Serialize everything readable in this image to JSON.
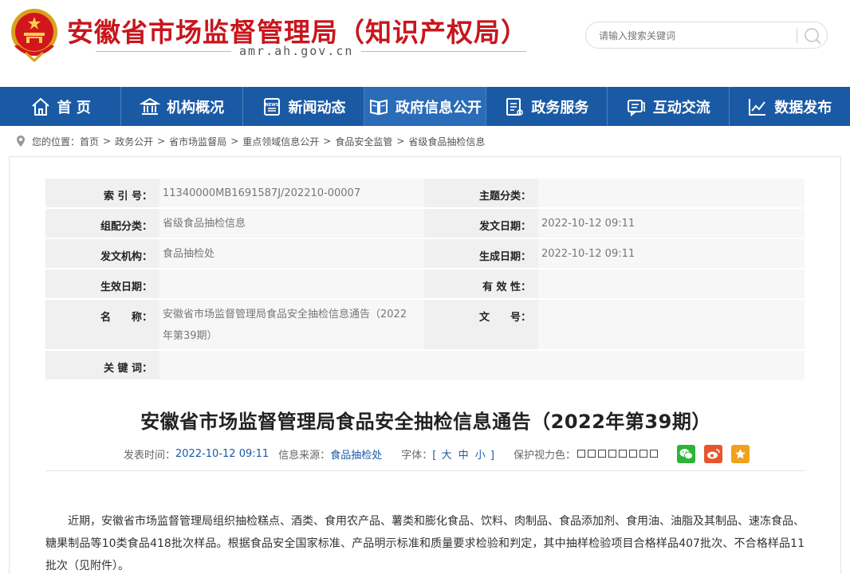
{
  "header": {
    "title": "安徽省市场监督管理局（知识产权局）",
    "domain": "amr.ah.gov.cn",
    "search_placeholder": "请输入搜索关键词"
  },
  "colors": {
    "brand_red": "#c8161d",
    "nav_blue": "#1a5aa5"
  },
  "nav": [
    {
      "label": "首 页",
      "icon": "home-icon"
    },
    {
      "label": "机构概况",
      "icon": "building-icon"
    },
    {
      "label": "新闻动态",
      "icon": "news-icon"
    },
    {
      "label": "政府信息公开",
      "icon": "info-open-icon"
    },
    {
      "label": "政务服务",
      "icon": "service-icon"
    },
    {
      "label": "互动交流",
      "icon": "chat-icon"
    },
    {
      "label": "数据发布",
      "icon": "chart-icon"
    }
  ],
  "breadcrumb": {
    "prefix": "您的位置：",
    "items": [
      "首页",
      "政务公开",
      "省市场监督局",
      "重点领域信息公开",
      "食品安全监管",
      "省级食品抽检信息"
    ]
  },
  "info": {
    "index_label": "索 引 号：",
    "index_value": "11340000MB1691587J/202210-00007",
    "topic_label": "主题分类：",
    "topic_value": "",
    "group_label": "组配分类：",
    "group_value": "省级食品抽检信息",
    "pubdate_label": "发文日期：",
    "pubdate_value": "2022-10-12 09:11",
    "org_label": "发文机构：",
    "org_value": "食品抽检处",
    "gendate_label": "生成日期：",
    "gendate_value": "2022-10-12 09:11",
    "effdate_label": "生效日期：",
    "effdate_value": "",
    "validity_label": "有 效 性：",
    "validity_value": "",
    "name_label": "名　　称：",
    "name_value": "安徽省市场监督管理局食品安全抽检信息通告（2022年第39期）",
    "docno_label": "文　　号：",
    "docno_value": "",
    "keyword_label": "关 键 词：",
    "keyword_value": ""
  },
  "article": {
    "title": "安徽省市场监督管理局食品安全抽检信息通告（2022年第39期）",
    "meta": {
      "time_label": "发表时间：",
      "time_value": "2022-10-12 09:11",
      "source_label": "信息来源：",
      "source_value": "食品抽检处",
      "font_label": "字体：",
      "font_open": "[",
      "font_large": "大",
      "font_medium": "中",
      "font_small": "小",
      "font_close": "]",
      "vision_label": "保护视力色："
    },
    "body": "近期，安徽省市场监督管理局组织抽检糕点、酒类、食用农产品、薯类和膨化食品、饮料、肉制品、食品添加剂、食用油、油脂及其制品、速冻食品、糖果制品等10类食品418批次样品。根据食品安全国家标准、产品明示标准和质量要求检验和判定，其中抽样检验项目合格样品407批次、不合格样品11批次（见附件）。"
  }
}
